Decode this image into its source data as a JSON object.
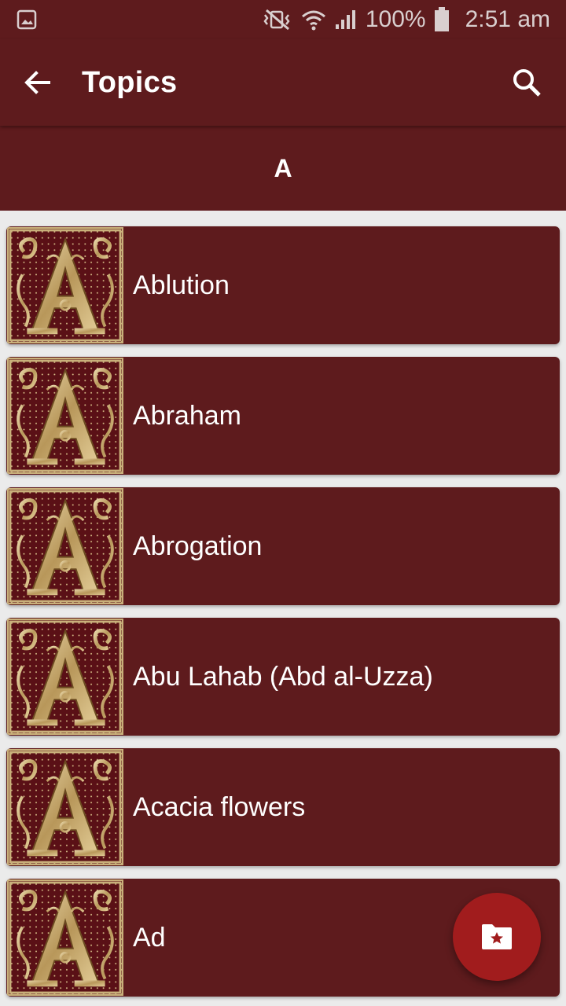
{
  "status_bar": {
    "battery": "100%",
    "time": "2:51 am"
  },
  "app_bar": {
    "title": "Topics",
    "back_icon": "arrow-back-icon",
    "search_icon": "search-icon"
  },
  "section": {
    "letter": "A"
  },
  "topics": [
    {
      "label": "Ablution",
      "thumb_icon": "illuminated-letter-a-icon"
    },
    {
      "label": "Abraham",
      "thumb_icon": "illuminated-letter-a-icon"
    },
    {
      "label": "Abrogation",
      "thumb_icon": "illuminated-letter-a-icon"
    },
    {
      "label": "Abu Lahab (Abd al-Uzza)",
      "thumb_icon": "illuminated-letter-a-icon"
    },
    {
      "label": "Acacia flowers",
      "thumb_icon": "illuminated-letter-a-icon"
    },
    {
      "label": "Ad",
      "thumb_icon": "illuminated-letter-a-icon"
    }
  ],
  "fab": {
    "icon": "folder-star-icon"
  },
  "colors": {
    "primary": "#5e1b1d",
    "fab": "#a11c1d",
    "gold": "#c9b07a",
    "background": "#ebebeb"
  }
}
